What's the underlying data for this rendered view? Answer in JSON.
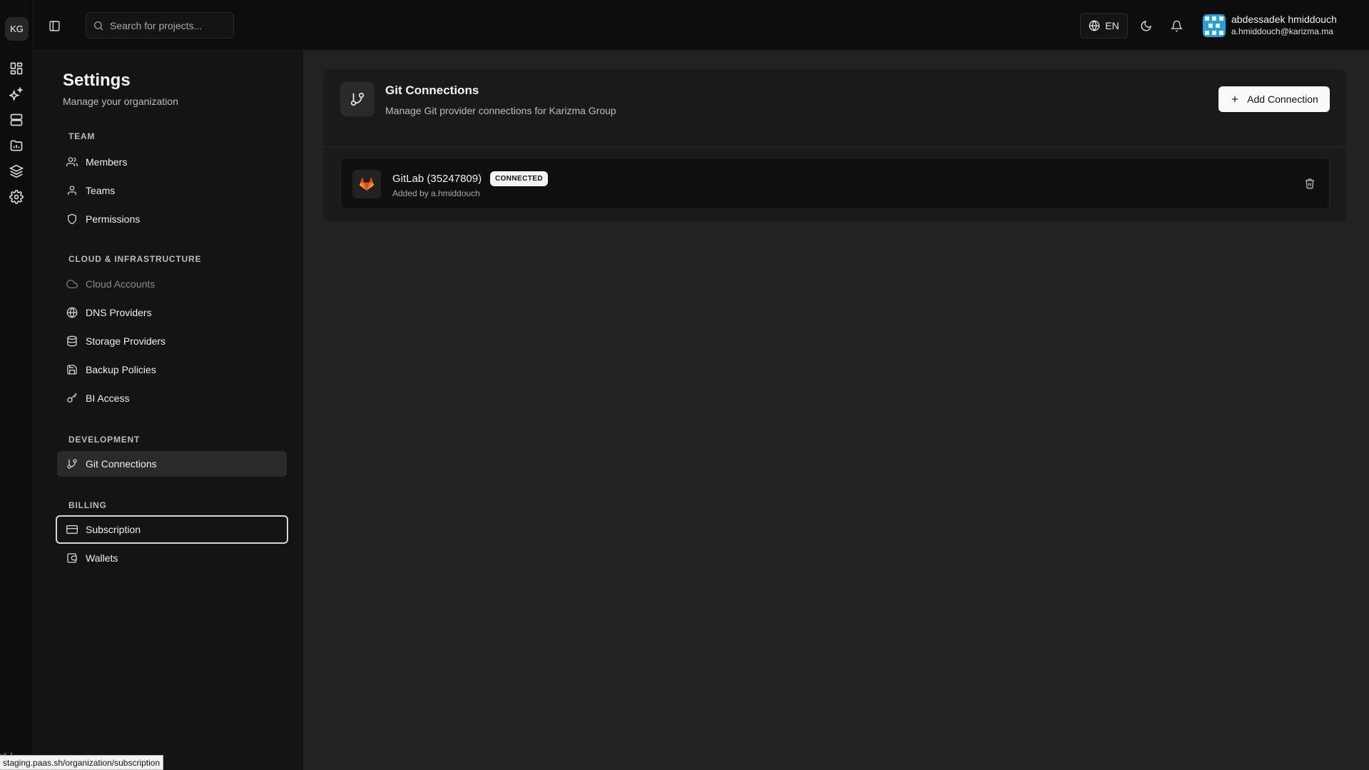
{
  "rail": {
    "org_initials": "KG",
    "icons": [
      "dashboard-icon",
      "sparkles-icon",
      "server-icon",
      "projects-folder-icon",
      "layers-icon",
      "settings-gear-icon"
    ],
    "version": "v1.1"
  },
  "topbar": {
    "search_placeholder": "Search for projects...",
    "language": "EN",
    "user": {
      "name": "abdessadek hmiddouch",
      "email": "a.hmiddouch@karizma.ma"
    }
  },
  "settings": {
    "title": "Settings",
    "subtitle": "Manage your organization",
    "sections": {
      "team": {
        "label": "TEAM",
        "items": [
          "Members",
          "Teams",
          "Permissions"
        ]
      },
      "cloud": {
        "label": "CLOUD & INFRASTRUCTURE",
        "items": [
          "Cloud Accounts",
          "DNS Providers",
          "Storage Providers",
          "Backup Policies",
          "BI Access"
        ]
      },
      "development": {
        "label": "DEVELOPMENT",
        "items": [
          "Git Connections"
        ]
      },
      "billing": {
        "label": "BILLING",
        "items": [
          "Subscription",
          "Wallets"
        ]
      }
    },
    "active_item": "Git Connections"
  },
  "main": {
    "title": "Git Connections",
    "description": "Manage Git provider connections for Karizma Group",
    "add_button": "Add Connection",
    "connections": [
      {
        "name": "GitLab (35247809)",
        "status": "CONNECTED",
        "added_by": "Added by a.hmiddouch"
      }
    ]
  },
  "status_bar": {
    "url": "staging.paas.sh/organization/subscription"
  },
  "colors": {
    "background": "#0d0d0d",
    "sidebar": "#141414",
    "main": "#222222",
    "gitlab_orange": "#e24329"
  }
}
